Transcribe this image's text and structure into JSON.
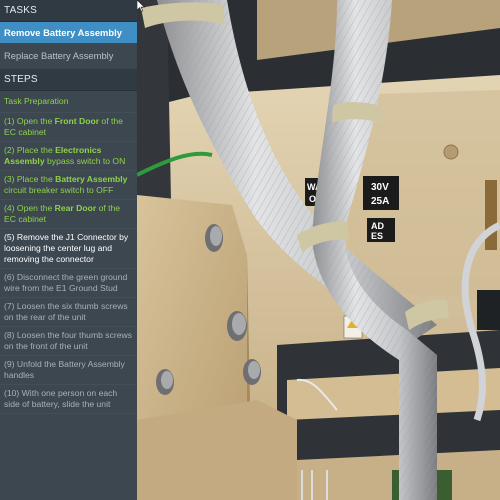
{
  "sidebar": {
    "tasks_header": "TASKS",
    "tasks": [
      {
        "label": "Remove Battery Assembly",
        "active": true
      },
      {
        "label": "Replace Battery Assembly",
        "active": false
      }
    ],
    "steps_header": "STEPS",
    "prep_label": "Task Preparation",
    "steps": [
      {
        "parts": [
          {
            "t": "(1) Open the "
          },
          {
            "t": "Front Door",
            "b": true
          },
          {
            "t": " of the EC cabinet"
          }
        ],
        "status": "done"
      },
      {
        "parts": [
          {
            "t": "(2) Place the "
          },
          {
            "t": "Electronics Assembly",
            "b": true
          },
          {
            "t": " bypass switch to ON"
          }
        ],
        "status": "done"
      },
      {
        "parts": [
          {
            "t": "(3) Place the "
          },
          {
            "t": "Battery Assembly",
            "b": true
          },
          {
            "t": " circuit breaker switch to OFF"
          }
        ],
        "status": "done"
      },
      {
        "parts": [
          {
            "t": "(4) Open the "
          },
          {
            "t": "Rear Door",
            "b": true
          },
          {
            "t": " of the EC cabinet"
          }
        ],
        "status": "done"
      },
      {
        "parts": [
          {
            "t": "(5) Remove the J1 Connector by loosening the center lug and removing the connector"
          }
        ],
        "status": "current"
      },
      {
        "parts": [
          {
            "t": "(6) Disconnect the green ground wire from the E1 Ground Stud"
          }
        ],
        "status": "pending"
      },
      {
        "parts": [
          {
            "t": "(7) Loosen the six thumb screws on the rear of the unit"
          }
        ],
        "status": "pending"
      },
      {
        "parts": [
          {
            "t": "(8) Loosen the four thumb screws on the front of the unit"
          }
        ],
        "status": "pending"
      },
      {
        "parts": [
          {
            "t": "(9) Unfold the Battery Assembly handles"
          }
        ],
        "status": "pending"
      },
      {
        "parts": [
          {
            "t": "(10) With one person on each side of battery, slide the unit"
          }
        ],
        "status": "pending"
      }
    ]
  },
  "viewport": {
    "labels": {
      "warn": "WAR",
      "v30": "30V",
      "a25": "25A",
      "ol": "OL",
      "ad": "AD",
      "es": "ES"
    }
  },
  "colors": {
    "sidebar_bg": "#3c4750",
    "header_bg": "#2f3a42",
    "active_task": "#3f8fc4",
    "done_step": "#8fd24b",
    "current_step": "#ffffff",
    "pending_step": "#a7b1b7",
    "panel_tan": "#d7c29c",
    "cable": "#c9cacc"
  }
}
